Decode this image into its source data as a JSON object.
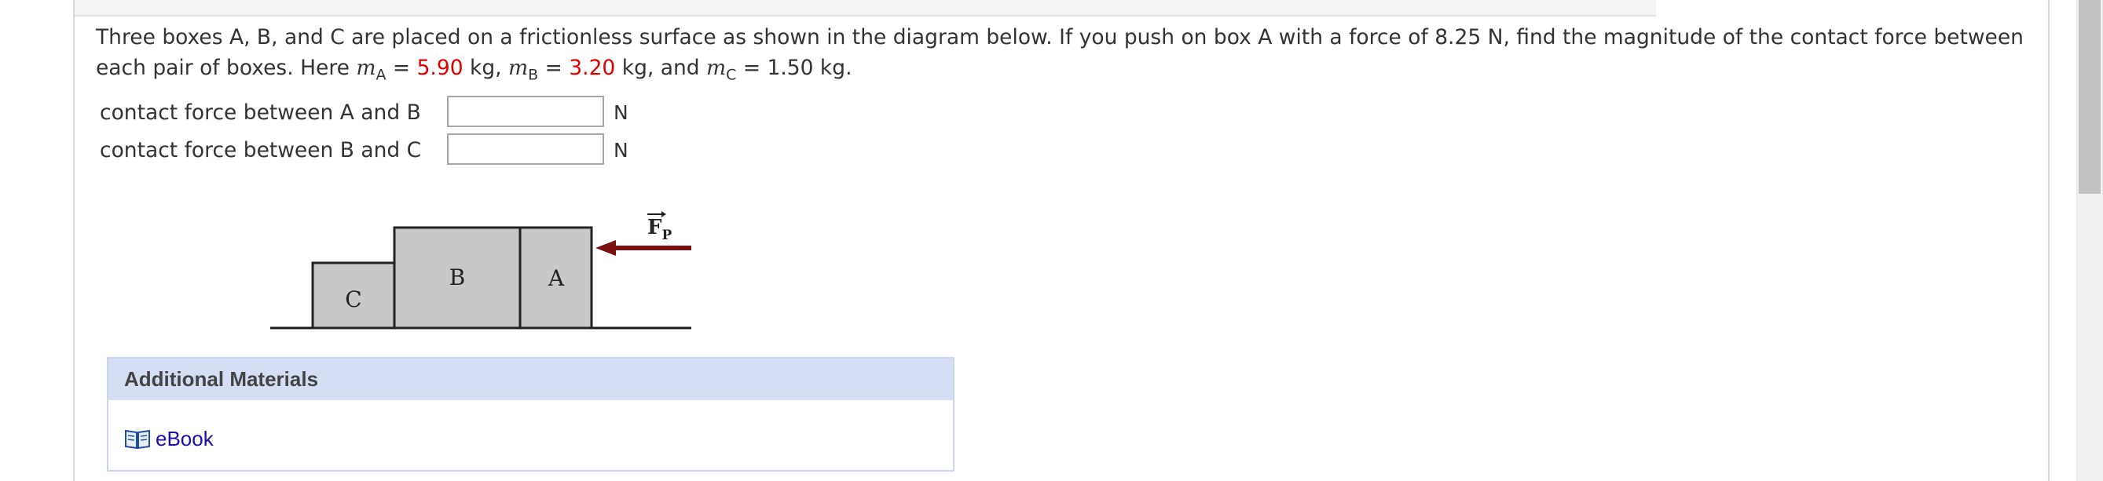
{
  "question": {
    "text_before": "Three boxes A, B, and C are placed on a frictionless surface as shown in the diagram below. If you push on box A with a force of 8.25 N, find the magnitude of the contact force between each pair of boxes. Here ",
    "mA_symbol": "m",
    "mA_sub": "A",
    "eq1": " = ",
    "mA_value": "5.90",
    "mA_unit": " kg, ",
    "mB_symbol": "m",
    "mB_sub": "B",
    "eq2": " = ",
    "mB_value": "3.20",
    "mB_unit": " kg, and ",
    "mC_symbol": "m",
    "mC_sub": "C",
    "mC_rest": " = 1.50 kg.",
    "highlight_color": "#e00000"
  },
  "answers": [
    {
      "label": "contact force between A and B",
      "value": "",
      "unit": "N"
    },
    {
      "label": "contact force between B and C",
      "value": "",
      "unit": "N"
    }
  ],
  "diagram": {
    "box_c_label": "C",
    "box_b_label": "B",
    "box_a_label": "A",
    "force_label": "F",
    "force_sub": "P",
    "box_fill": "#c8c8c8",
    "arrow_color": "#7a1010"
  },
  "additional_materials": {
    "title": "Additional Materials",
    "ebook_label": "eBook",
    "ebook_icon": "book-icon"
  }
}
